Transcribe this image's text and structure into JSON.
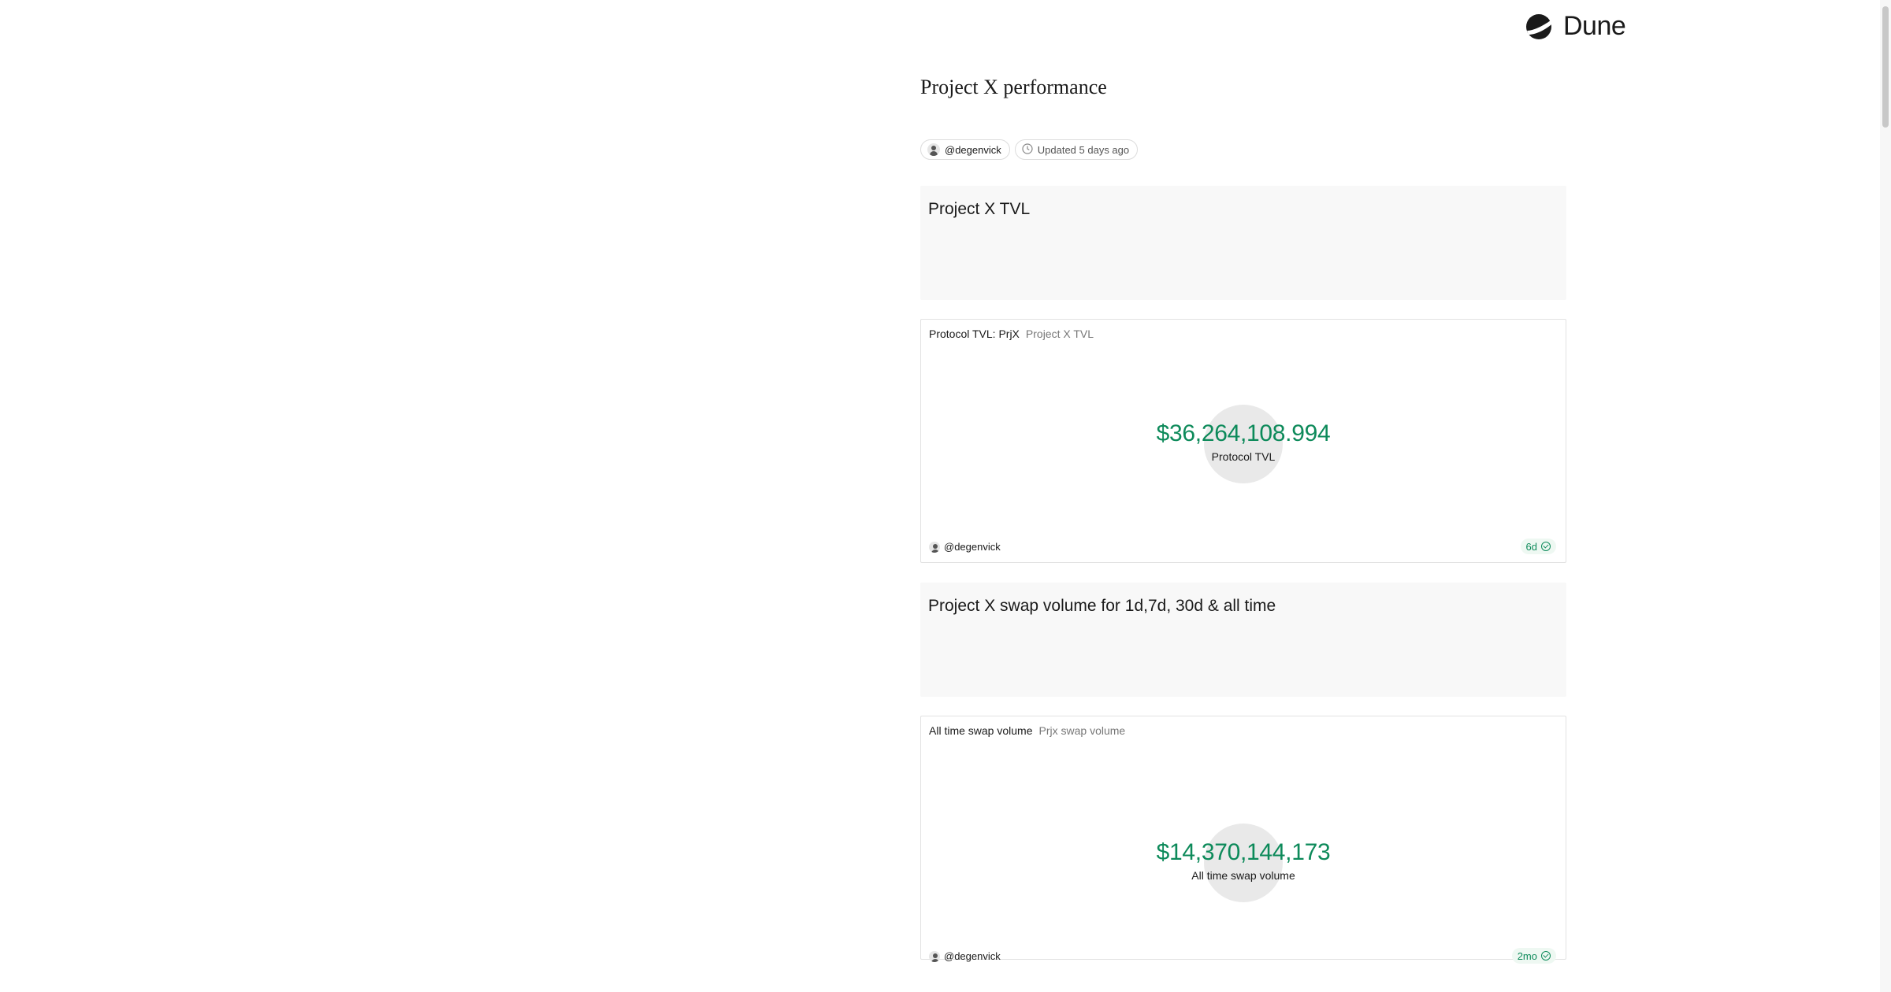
{
  "brand": {
    "name": "Dune",
    "icon": "dune-logo-icon"
  },
  "dashboard": {
    "title": "Project X performance",
    "author": "@degenvick",
    "updated": "Updated 5 days ago"
  },
  "sections": [
    {
      "heading": "Project X TVL"
    },
    {
      "heading": "Project X swap volume for 1d,7d, 30d & all time"
    }
  ],
  "counters": [
    {
      "name": "Protocol TVL: PrjX",
      "query": "Project X TVL",
      "value": "$36,264,108.994",
      "label": "Protocol TVL",
      "author": "@degenvick",
      "age": "6d"
    },
    {
      "name": "All time swap volume",
      "query": "Prjx swap volume",
      "value": "$14,370,144,173",
      "label": "All time swap volume",
      "author": "@degenvick",
      "age": "2mo"
    }
  ],
  "colors": {
    "accent": "#0d8a5a",
    "card_bg": "#f8f8f8",
    "border": "#e2e2e2"
  }
}
